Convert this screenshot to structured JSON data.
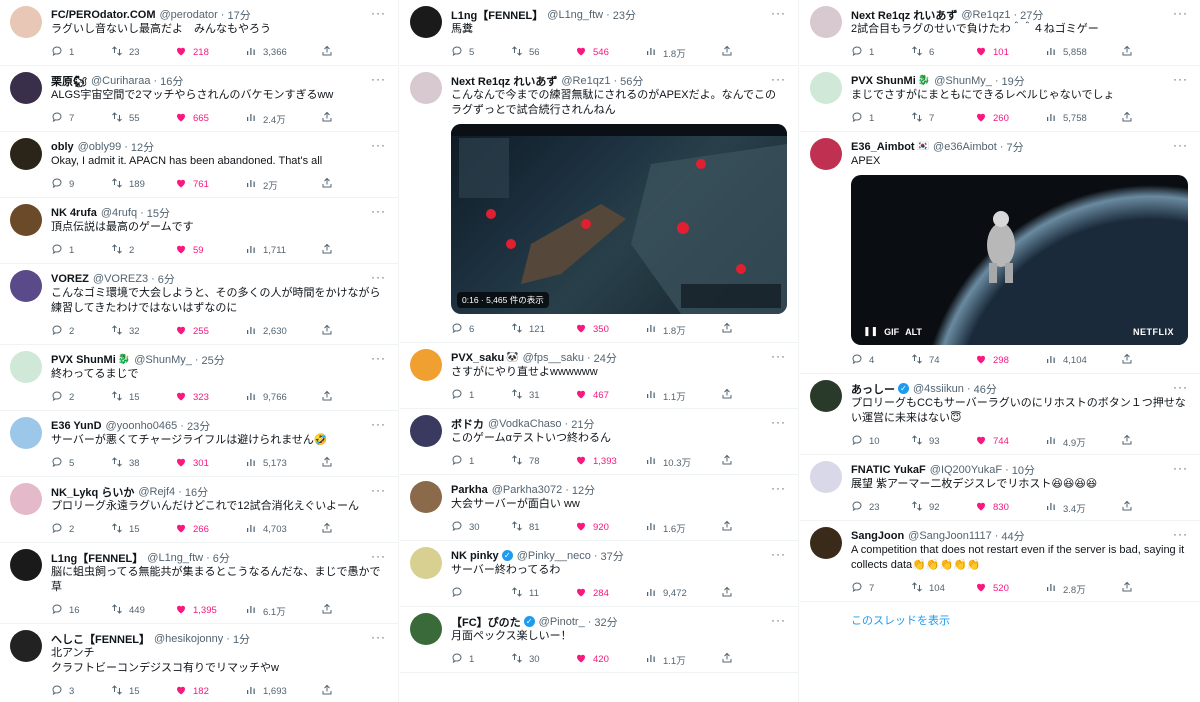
{
  "columns": [
    [
      {
        "name": "FC/PEROdator.COM",
        "handle": "@perodator",
        "time": "17分",
        "text": "ラグいし音ないし最高だよ　みんなもやろう",
        "replies": "1",
        "retweets": "23",
        "likes": "218",
        "views": "3,366",
        "avatar_color": "#e8c7b6",
        "avatar_glyph": ""
      },
      {
        "name": "栗原🐿",
        "handle": "@Curiharaa",
        "time": "16分",
        "text": "ALGS宇宙空間で2マッチやらされんのバケモンすぎるww",
        "replies": "7",
        "retweets": "55",
        "likes": "665",
        "views": "2.4万",
        "avatar_color": "#3a2f4a",
        "avatar_glyph": ""
      },
      {
        "name": "obly",
        "handle": "@obly99",
        "time": "12分",
        "text": "Okay, I admit it. APACN has been abandoned. That's all",
        "replies": "9",
        "retweets": "189",
        "likes": "761",
        "views": "2万",
        "avatar_color": "#2b2418",
        "avatar_glyph": ""
      },
      {
        "name": "NK 4rufa",
        "handle": "@4rufq",
        "time": "15分",
        "text": "頂点伝説は最高のゲームです",
        "replies": "1",
        "retweets": "2",
        "likes": "59",
        "views": "1,711",
        "avatar_color": "#6b4a2a",
        "avatar_glyph": ""
      },
      {
        "name": "VOREZ",
        "handle": "@VOREZ3",
        "time": "6分",
        "text": "こんなゴミ環境で大会しようと、その多くの人が時間をかけながら練習してきたわけではないはずなのに",
        "replies": "2",
        "retweets": "32",
        "likes": "255",
        "views": "2,630",
        "avatar_color": "#5a4a8a",
        "avatar_glyph": ""
      },
      {
        "name": "PVX ShunMi",
        "badge": "🐉",
        "handle": "@ShunMy_",
        "time": "25分",
        "text": "終わってるまじで",
        "replies": "2",
        "retweets": "15",
        "likes": "323",
        "views": "9,766",
        "avatar_color": "#cfe8d8",
        "avatar_glyph": ""
      },
      {
        "name": "E36 YunD",
        "handle": "@yoonho0465",
        "time": "23分",
        "text": "サーバーが悪くてチャージライフルは避けられません🤣",
        "replies": "5",
        "retweets": "38",
        "likes": "301",
        "views": "5,173",
        "avatar_color": "#9cc7e8",
        "avatar_glyph": ""
      },
      {
        "name": "NK_Lykq らいか",
        "handle": "@Rejf4",
        "time": "16分",
        "text": "プロリーグ永遠ラグいんだけどこれで12試合消化えぐいよーん",
        "replies": "2",
        "retweets": "15",
        "likes": "266",
        "views": "4,703",
        "avatar_color": "#e4b9c9",
        "avatar_glyph": ""
      },
      {
        "name": "L1ng【FENNEL】",
        "handle": "@L1ng_ftw",
        "time": "6分",
        "text": "脳に蛆虫飼ってる無能共が集まるとこうなるんだな、まじで愚かで草",
        "replies": "16",
        "retweets": "449",
        "likes": "1,395",
        "views": "6.1万",
        "avatar_color": "#1a1a1a",
        "avatar_glyph": ""
      },
      {
        "name": "へしこ【FENNEL】",
        "handle": "@hesikojonny",
        "time": "1分",
        "text": "北アンチ\nクラフトビーコンデジスコ有りでリマッチやw",
        "replies": "3",
        "retweets": "15",
        "likes": "182",
        "views": "1,693",
        "avatar_color": "#222222",
        "avatar_glyph": ""
      }
    ],
    [
      {
        "name": "L1ng【FENNEL】",
        "handle": "@L1ng_ftw",
        "time": "23分",
        "text": "馬糞",
        "replies": "5",
        "retweets": "56",
        "likes": "546",
        "views": "1.8万",
        "avatar_color": "#1a1a1a",
        "avatar_glyph": ""
      },
      {
        "name": "Next Re1qz れいあず",
        "handle": "@Re1qz1",
        "time": "56分",
        "text": "こんなんで今までの練習無駄にされるのがAPEXだよ。なんでこのラグずっとで試合続行されんねん",
        "media": "video",
        "media_caption": "0:16 · 5,465 件の表示",
        "replies": "6",
        "retweets": "121",
        "likes": "350",
        "views": "1.8万",
        "avatar_color": "#d8c8d0",
        "avatar_glyph": ""
      },
      {
        "name": "PVX_saku",
        "badge": "🐼",
        "handle": "@fps__saku",
        "time": "24分",
        "text": "さすがにやり直せよwwwwww",
        "replies": "1",
        "retweets": "31",
        "likes": "467",
        "views": "1.1万",
        "avatar_color": "#f0a030",
        "avatar_glyph": ""
      },
      {
        "name": "ボドカ",
        "handle": "@VodkaChaso",
        "time": "21分",
        "text": "このゲームαテストいつ終わるん",
        "replies": "1",
        "retweets": "78",
        "likes": "1,393",
        "views": "10.3万",
        "avatar_color": "#3a3a60",
        "avatar_glyph": ""
      },
      {
        "name": "Parkha",
        "handle": "@Parkha3072",
        "time": "12分",
        "text": "大会サーバーが面白い ww",
        "replies": "30",
        "retweets": "81",
        "likes": "920",
        "views": "1.6万",
        "avatar_color": "#8a6a4a",
        "avatar_glyph": ""
      },
      {
        "name": "NK pinky",
        "verified": true,
        "handle": "@Pinky__neco",
        "time": "37分",
        "text": "サーバー終わってるわ",
        "replies": "",
        "retweets": "11",
        "likes": "284",
        "views": "9,472",
        "avatar_color": "#d8d090",
        "avatar_glyph": ""
      },
      {
        "name": "【FC】ぴのた",
        "verified": true,
        "handle": "@Pinotr_",
        "time": "32分",
        "text": "月面ペックス楽しいー！",
        "replies": "1",
        "retweets": "30",
        "likes": "420",
        "views": "1.1万",
        "avatar_color": "#3a6a3a",
        "avatar_glyph": ""
      }
    ],
    [
      {
        "name": "Next Re1qz れいあず",
        "handle": "@Re1qz1",
        "time": "27分",
        "text": "2試合目もラグのせいで負けたわ＾＾４ねゴミゲー",
        "replies": "1",
        "retweets": "6",
        "likes": "101",
        "views": "5,858",
        "avatar_color": "#d8c8d0",
        "avatar_glyph": ""
      },
      {
        "name": "PVX ShunMi",
        "badge": "🐉",
        "handle": "@ShunMy_",
        "time": "19分",
        "text": "まじでさすがにまともにできるレベルじゃないでしょ",
        "replies": "1",
        "retweets": "7",
        "likes": "260",
        "views": "5,758",
        "avatar_color": "#cfe8d8",
        "avatar_glyph": ""
      },
      {
        "name": "E36_Aimbot",
        "badge": "🇰🇷",
        "handle": "@e36Aimbot",
        "time": "7分",
        "text": "APEX",
        "media": "gif",
        "media_gif": "GIF",
        "media_alt": "ALT",
        "media_brand": "NETFLIX",
        "replies": "4",
        "retweets": "74",
        "likes": "298",
        "views": "4,104",
        "avatar_color": "#c03050",
        "avatar_glyph": ""
      },
      {
        "name": "あっしー",
        "verified": true,
        "handle": "@4ssiikun",
        "time": "46分",
        "text": "プロリーグもCCもサーバーラグいのにリホストのボタン１つ押せない運営に未来はない😇",
        "replies": "10",
        "retweets": "93",
        "likes": "744",
        "views": "4.9万",
        "avatar_color": "#2a3a2a",
        "avatar_glyph": ""
      },
      {
        "name": "FNATIC YukaF",
        "handle": "@IQ200YukaF",
        "time": "10分",
        "text": "展望 紫アーマー二枚デジスレでリホスト😆😆😆😆",
        "replies": "23",
        "retweets": "92",
        "likes": "830",
        "views": "3.4万",
        "avatar_color": "#d8d8e8",
        "avatar_glyph": ""
      },
      {
        "name": "SangJoon",
        "handle": "@SangJoon1117",
        "time": "44分",
        "text": "A competition that does not restart even if the server is bad, saying it collects data👏👏👏👏👏",
        "replies": "7",
        "retweets": "104",
        "likes": "520",
        "views": "2.8万",
        "avatar_color": "#3a2a1a",
        "avatar_glyph": ""
      }
    ]
  ],
  "thread_link": "このスレッドを表示",
  "colors": {
    "like": "#f91880",
    "link": "#1d9bf0",
    "muted": "#536471"
  }
}
